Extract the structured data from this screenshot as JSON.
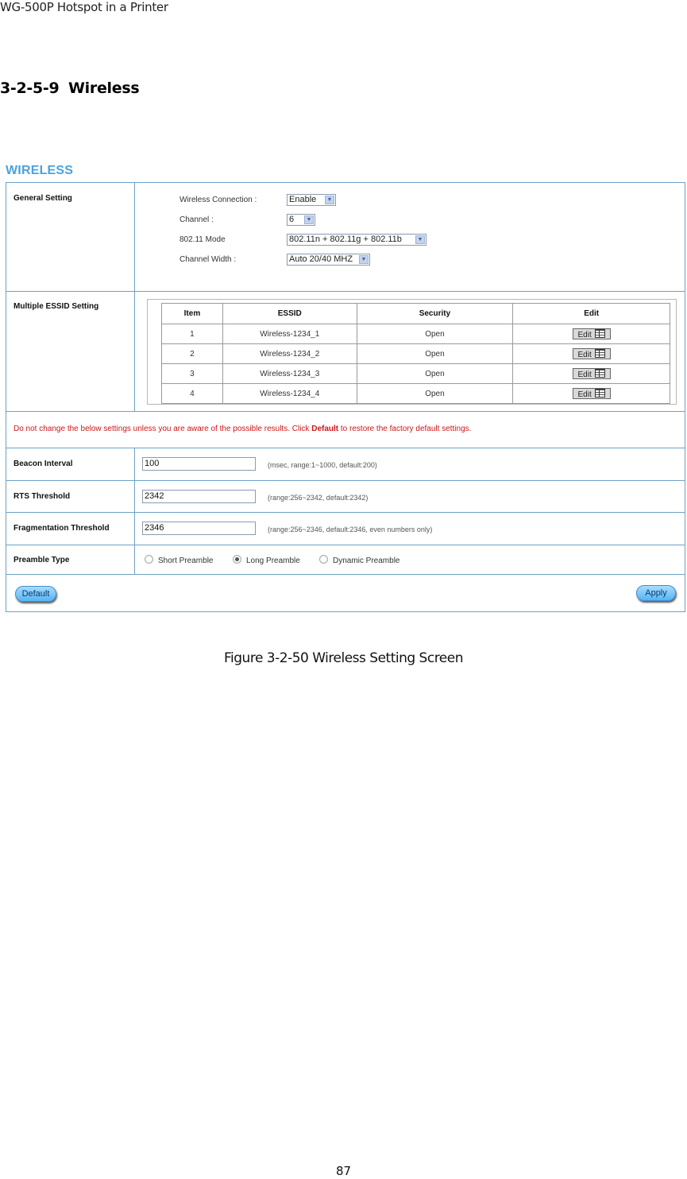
{
  "document": {
    "header": "WG-500P Hotspot in a Printer",
    "section_number": "3-2-5-9",
    "section_title": "Wireless",
    "caption": "Figure 3-2-50 Wireless Setting Screen",
    "page_number": "87"
  },
  "panel": {
    "title": "WIRELESS",
    "general_setting": {
      "label": "General Setting",
      "fields": [
        {
          "label": "Wireless Connection :",
          "value": "Enable"
        },
        {
          "label": "Channel :",
          "value": "6"
        },
        {
          "label": "802.11 Mode",
          "value": "802.11n + 802.11g + 802.11b"
        },
        {
          "label": "Channel Width :",
          "value": "Auto 20/40 MHZ"
        }
      ]
    },
    "essid_setting": {
      "label": "Multiple ESSID Setting",
      "columns": [
        "Item",
        "ESSID",
        "Security",
        "Edit"
      ],
      "rows": [
        {
          "item": "1",
          "essid": "Wireless-1234_1",
          "security": "Open",
          "edit": "Edit"
        },
        {
          "item": "2",
          "essid": "Wireless-1234_2",
          "security": "Open",
          "edit": "Edit"
        },
        {
          "item": "3",
          "essid": "Wireless-1234_3",
          "security": "Open",
          "edit": "Edit"
        },
        {
          "item": "4",
          "essid": "Wireless-1234_4",
          "security": "Open",
          "edit": "Edit"
        }
      ]
    },
    "warning": {
      "before": "Do not change the below settings unless you are aware of the possible results. Click ",
      "bold": "Default",
      "after": " to restore the factory default settings."
    },
    "beacon_interval": {
      "label": "Beacon Interval",
      "value": "100",
      "hint": "(msec, range:1~1000, default:200)"
    },
    "rts_threshold": {
      "label": "RTS Threshold",
      "value": "2342",
      "hint": "(range:256~2342, default:2342)"
    },
    "fragmentation_threshold": {
      "label": "Fragmentation Threshold",
      "value": "2346",
      "hint": "(range:256~2346, default:2346, even numbers only)"
    },
    "preamble_type": {
      "label": "Preamble Type",
      "options": [
        "Short Preamble",
        "Long Preamble",
        "Dynamic Preamble"
      ],
      "selected": "Long Preamble"
    },
    "buttons": {
      "default": "Default",
      "apply": "Apply"
    }
  },
  "colors": {
    "title_blue": "#4aa3df",
    "border_blue": "#6da2c7",
    "warning_red": "#d01616"
  }
}
